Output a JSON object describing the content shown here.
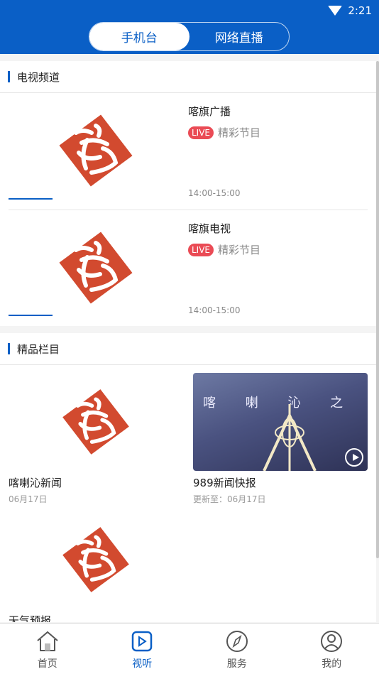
{
  "status": {
    "time": "2:21"
  },
  "header": {
    "tabs": [
      {
        "label": "手机台",
        "active": true
      },
      {
        "label": "网络直播",
        "active": false
      }
    ]
  },
  "tv_section": {
    "title": "电视频道",
    "channels": [
      {
        "name": "喀旗广播",
        "badge": "LIVE",
        "program": "精彩节目",
        "time": "14:00-15:00"
      },
      {
        "name": "喀旗电视",
        "badge": "LIVE",
        "program": "精彩节目",
        "time": "14:00-15:00"
      }
    ]
  },
  "featured_section": {
    "title": "精品栏目",
    "items": [
      {
        "title": "喀喇沁新闻",
        "sub": "06月17日"
      },
      {
        "title": "989新闻快报",
        "sub": "更新至：06月17日",
        "thumb_text": "喀 喇 沁 之 声"
      },
      {
        "title": "天气预报",
        "sub": ""
      }
    ]
  },
  "bottom_nav": {
    "items": [
      {
        "label": "首页",
        "icon": "home-icon",
        "active": false
      },
      {
        "label": "视听",
        "icon": "play-icon",
        "active": true
      },
      {
        "label": "服务",
        "icon": "compass-icon",
        "active": false
      },
      {
        "label": "我的",
        "icon": "user-icon",
        "active": false
      }
    ]
  },
  "colors": {
    "primary": "#0a5fc6",
    "live": "#ea4b55",
    "logo": "#d24a2f"
  }
}
